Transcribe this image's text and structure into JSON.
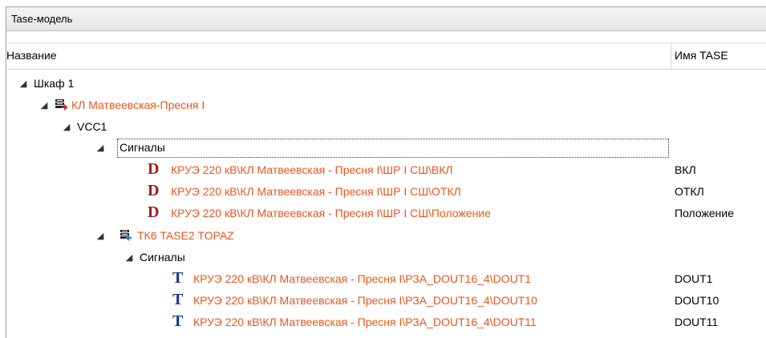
{
  "window": {
    "title": "Tase-модель"
  },
  "columns": {
    "name": "Название",
    "tase": "Имя TASE"
  },
  "tree": {
    "cabinet": "Шкаф 1",
    "device1": "КЛ Матвеевская-Пресня I",
    "vcc": "VCC1",
    "signals1": "Сигналы",
    "d1": {
      "name": "КРУЭ 220 кВ\\КЛ Матвеевская - Пресня I\\ШР I СШ\\ВКЛ",
      "tase": "ВКЛ"
    },
    "d2": {
      "name": "КРУЭ 220 кВ\\КЛ Матвеевская - Пресня I\\ШР I СШ\\ОТКЛ",
      "tase": "ОТКЛ"
    },
    "d3": {
      "name": "КРУЭ 220 кВ\\КЛ Матвеевская - Пресня I\\ШР I СШ\\Положение",
      "tase": "Положение"
    },
    "device2": "ТК6 TASE2 TOPAZ",
    "signals2": "Сигналы",
    "t1": {
      "name": "КРУЭ 220 кВ\\КЛ Матвеевская - Пресня I\\РЗА_DOUT16_4\\DOUT1",
      "tase": "DOUT1"
    },
    "t2": {
      "name": "КРУЭ 220 кВ\\КЛ Матвеевская - Пресня I\\РЗА_DOUT16_4\\DOUT10",
      "tase": "DOUT10"
    },
    "t3": {
      "name": "КРУЭ 220 кВ\\КЛ Матвеевская - Пресня I\\РЗА_DOUT16_4\\DOUT11",
      "tase": "DOUT11"
    }
  },
  "icons": {
    "d_glyph": "D",
    "t_glyph": "T",
    "d_color": "#9c2020",
    "t_color": "#153a8a",
    "accent_orange": "#e8571c"
  }
}
